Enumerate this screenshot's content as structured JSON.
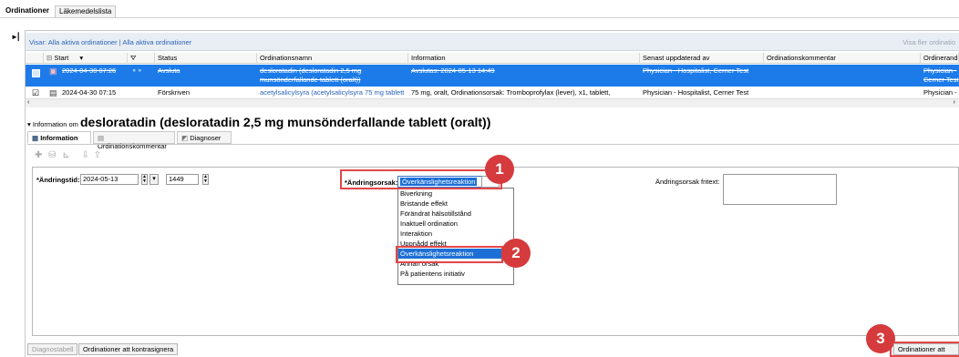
{
  "tabs": [
    {
      "label": "Ordinationer"
    },
    {
      "label": "Läkemedelslista"
    }
  ],
  "visar": {
    "prefix": "Visar:",
    "link1": "Alla aktiva ordinationer",
    "sep": "|",
    "link2": "Alla aktiva ordinationer",
    "right": "Visa fler ordinatio"
  },
  "grid": {
    "headers": [
      "Start",
      "Status",
      "Ordinationsnamn",
      "Information",
      "Senast uppdaterad av",
      "Ordinationskommentar",
      "Ordinerand"
    ],
    "rows": [
      {
        "start": "2024-04-30 07:26",
        "status": "Avsluta",
        "name_line1": "desloratadin (desloratadin 2,5 mg",
        "name_line2": "munsönderfallande tablett (oralt))",
        "info": "Avslutas: 2024-05-13 14:49",
        "updated_by": "Physician - Hospitalist, Cerner Test",
        "comment": "",
        "ordinerande_line1": "Physician -",
        "ordinerande_line2": "Cerner Test"
      },
      {
        "start": "2024-04-30 07:15",
        "status": "Förskriven",
        "name_line1": "acetylsalicylsyra (acetylsalicylsyra 75 mg tablett",
        "info": "75 mg, oralt, Ordinationsorsak: Tromboprofylax (lever), x1, tablett,",
        "updated_by": "Physician - Hospitalist, Cerner Test",
        "comment": "",
        "ordinerande_line1": "Physician -"
      }
    ]
  },
  "info_header": {
    "prefix": "Information om",
    "title": "desloratadin (desloratadin 2,5 mg munsönderfallande tablett (oralt))"
  },
  "subtabs": [
    {
      "label": "Information"
    },
    {
      "label": "Ordinationskommentar"
    },
    {
      "label": "Diagnoser"
    }
  ],
  "form": {
    "andringstid_label": "*Ändringstid:",
    "date_value": "2024-05-13",
    "time_value": "1449",
    "andringsorsak_label": "*Ändringsorsak:",
    "andringsorsak_value": "Överkänslighetsreaktion",
    "fritext_label": "Ändringsorsak fritext:"
  },
  "dropdown_options": [
    "Biverkning",
    "Bristande effekt",
    "Förändrat hälsotillstånd",
    "Inaktuell ordination",
    "Interaktion",
    "Uppnådd effekt",
    "Överkänslighetsreaktion",
    "Annan orsak",
    "På patientens initiativ"
  ],
  "dropdown_selected_index": 6,
  "callouts": [
    "1",
    "2",
    "3"
  ],
  "bottom_buttons": {
    "diagnostabell": "Diagnostabell",
    "kontrasignera": "Ordinationer att kontrasignera",
    "signera": "Ordinationer att signera"
  },
  "colors": {
    "selection": "#1c7be8",
    "callout": "#d53a3c",
    "highlight": "#1c6fd6"
  }
}
